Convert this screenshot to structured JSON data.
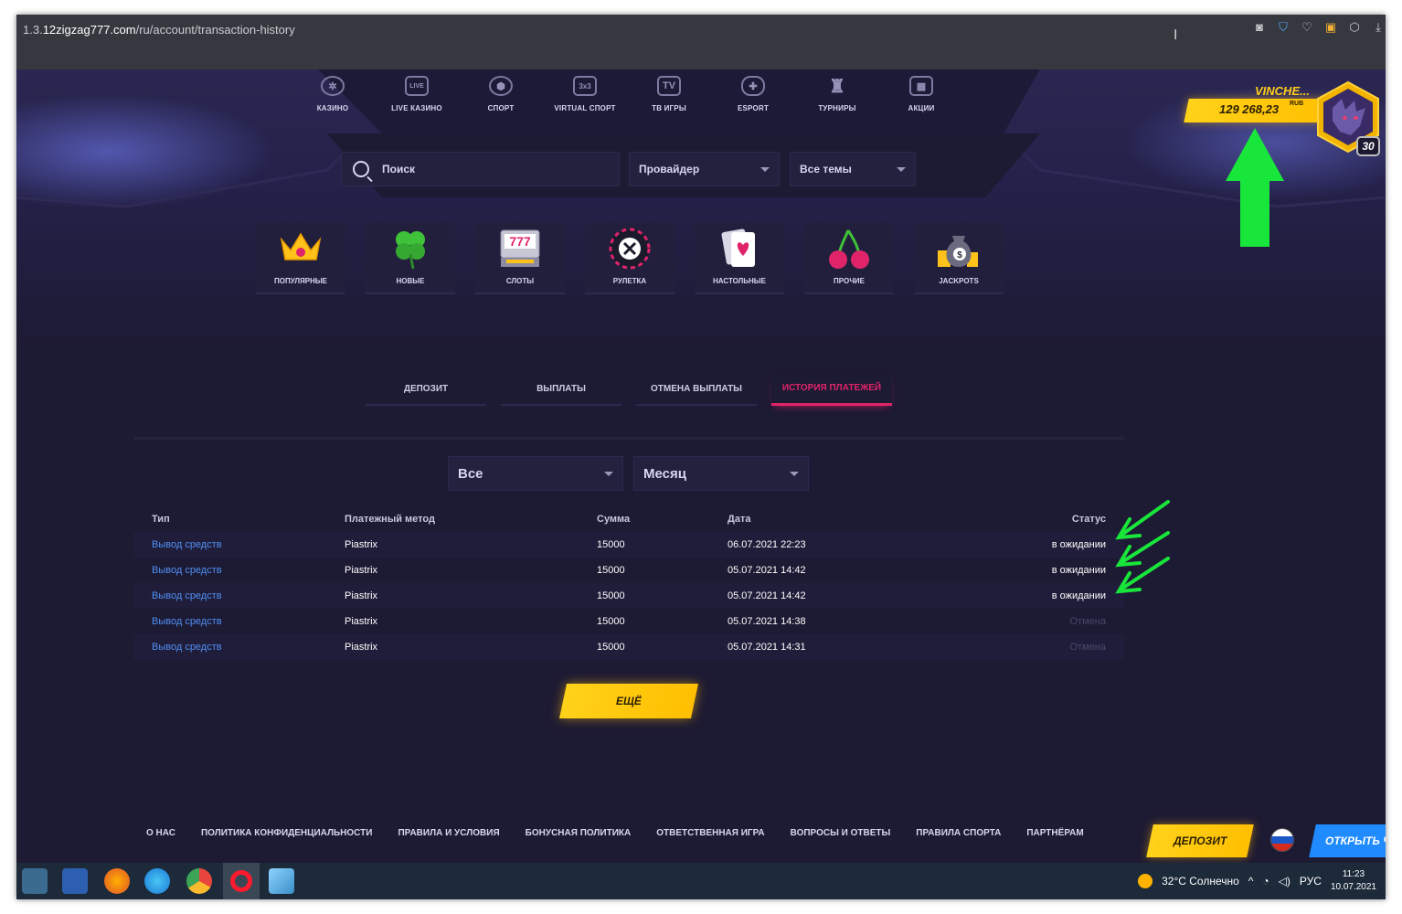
{
  "browser": {
    "url_prefix": "1.3.",
    "url_host": "12zigzag777.com",
    "url_path": "/ru/account/transaction-history"
  },
  "nav": {
    "items": [
      {
        "label": "КАЗИНО",
        "icon": "roulette-wheel-icon"
      },
      {
        "label": "LIVE КАЗИНО",
        "icon": "live-tv-icon",
        "glyph": "LIVE"
      },
      {
        "label": "СПОРТ",
        "icon": "soccer-ball-icon"
      },
      {
        "label": "VIRTUAL СПОРТ",
        "icon": "virtual-sport-icon",
        "glyph": "3x3"
      },
      {
        "label": "ТВ ИГРЫ",
        "icon": "tv-icon",
        "glyph": "TV"
      },
      {
        "label": "ESPORT",
        "icon": "gamepad-icon"
      },
      {
        "label": "ТУРНИРЫ",
        "icon": "trophy-icon"
      },
      {
        "label": "АКЦИИ",
        "icon": "gift-icon"
      }
    ]
  },
  "user": {
    "name": "VINCHE...",
    "balance": "129 268,23",
    "currency": "RUB",
    "level": "30"
  },
  "filters": {
    "search_placeholder": "Поиск",
    "provider": "Провайдер",
    "themes": "Все темы"
  },
  "categories": [
    {
      "label": "ПОПУЛЯРНЫЕ",
      "icon": "crown-icon"
    },
    {
      "label": "НОВЫЕ",
      "icon": "clover-icon"
    },
    {
      "label": "СЛОТЫ",
      "icon": "slot-machine-icon"
    },
    {
      "label": "РУЛЕТКА",
      "icon": "roulette-icon"
    },
    {
      "label": "НАСТОЛЬНЫЕ",
      "icon": "playing-card-icon"
    },
    {
      "label": "ПРОЧИЕ",
      "icon": "cherries-icon"
    },
    {
      "label": "JACKPOTS",
      "icon": "money-bag-icon"
    }
  ],
  "tabs": [
    {
      "label": "ДЕПОЗИТ",
      "active": false
    },
    {
      "label": "ВЫПЛАТЫ",
      "active": false
    },
    {
      "label": "ОТМЕНА ВЫПЛАТЫ",
      "active": false
    },
    {
      "label": "ИСТОРИЯ ПЛАТЕЖЕЙ",
      "active": true
    }
  ],
  "history_filters": {
    "type": "Все",
    "period": "Месяц"
  },
  "table": {
    "headers": [
      "Тип",
      "Платежный метод",
      "Сумма",
      "Дата",
      "Статус"
    ],
    "rows": [
      {
        "type": "Вывод средств",
        "method": "Piastrix",
        "amount": "15000",
        "date": "06.07.2021 22:23",
        "status": "в ожидании",
        "status_kind": "pending"
      },
      {
        "type": "Вывод средств",
        "method": "Piastrix",
        "amount": "15000",
        "date": "05.07.2021 14:42",
        "status": "в ожидании",
        "status_kind": "pending"
      },
      {
        "type": "Вывод средств",
        "method": "Piastrix",
        "amount": "15000",
        "date": "05.07.2021 14:42",
        "status": "в ожидании",
        "status_kind": "pending"
      },
      {
        "type": "Вывод средств",
        "method": "Piastrix",
        "amount": "15000",
        "date": "05.07.2021 14:38",
        "status": "Отмена",
        "status_kind": "cancel"
      },
      {
        "type": "Вывод средств",
        "method": "Piastrix",
        "amount": "15000",
        "date": "05.07.2021 14:31",
        "status": "Отмена",
        "status_kind": "cancel"
      }
    ]
  },
  "more_label": "ЕЩЁ",
  "footer": {
    "links": [
      "О НАС",
      "ПОЛИТИКА КОНФИДЕНЦИАЛЬНОСТИ",
      "ПРАВИЛА И УСЛОВИЯ",
      "БОНУСНАЯ ПОЛИТИКА",
      "ОТВЕТСТВЕННАЯ ИГРА",
      "ВОПРОСЫ И ОТВЕТЫ",
      "ПРАВИЛА СПОРТА",
      "ПАРТНЁРАМ"
    ],
    "deposit_label": "ДЕПОЗИТ",
    "open_label": "ОТКРЫТЬ Ч"
  },
  "taskbar": {
    "weather": "32°C  Солнечно",
    "lang": "РУС",
    "time": "11:23",
    "date": "10.07.2021"
  },
  "colors": {
    "accent_yellow": "#ffc400",
    "accent_pink": "#e0246a",
    "link_blue": "#4f8ff2",
    "annotation_green": "#19e63a",
    "background": "#1d1a33"
  }
}
